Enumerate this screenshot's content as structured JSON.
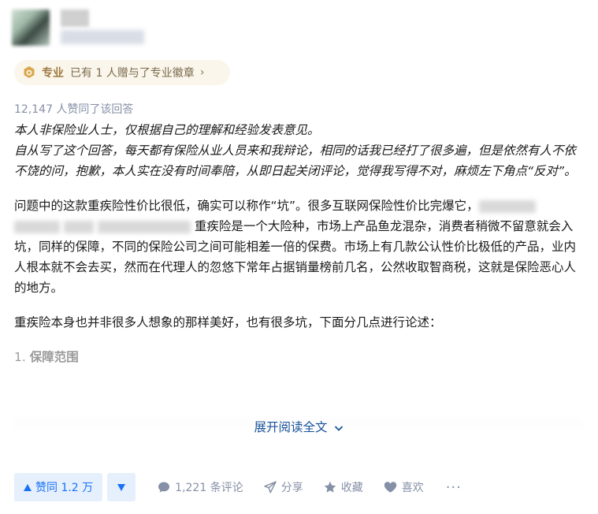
{
  "badge": {
    "title": "专业",
    "text": "已有 1 人赠与了专业徽章",
    "chevron": "›"
  },
  "likes_summary": "12,147 人赞同了该回答",
  "content": {
    "disclaimer_1": "本人非保险业人士，仅根据自己的理解和经验发表意见。",
    "disclaimer_2": "自从写了这个回答，每天都有保险从业人员来和我辩论，相同的话我已经打了很多遍，但是依然有人不依不饶的问，抱歉，本人实在没有时间奉陪，从即日起关闭评论，觉得我写得不对，麻烦左下角点“反对”。",
    "para_1_a": "问题中的这款重疾险性价比很低，确实可以称作“坑”。很多互联网保险性价比完爆它，",
    "para_1_b": "重疾险是一个大险种，市场上产品鱼龙混杂，消费者稍微不留意就会入坑，同样的保障，不同的保险公司之间可能相差一倍的保费。市场上有几款公认性价比极低的产品，业内人根本就不会去买，然而在代理人的忽悠下常年占据销量榜前几名，公然收取智商税，这就是保险恶心人的地方。",
    "para_2": "重疾险本身也并非很多人想象的那样美好，也有很多坑，下面分几点进行论述：",
    "section_number": "1. ",
    "section_title": "保障范围"
  },
  "expand_label": "展开阅读全文",
  "actions": {
    "upvote_label": "赞同 1.2 万",
    "comments_label": "1,221 条评论",
    "share_label": "分享",
    "favorite_label": "收藏",
    "like_label": "喜欢",
    "more_label": "···"
  },
  "colors": {
    "accent": "#1772f6",
    "link": "#175199",
    "muted": "#8590a6",
    "badge_bg": "#fbf6ec"
  }
}
